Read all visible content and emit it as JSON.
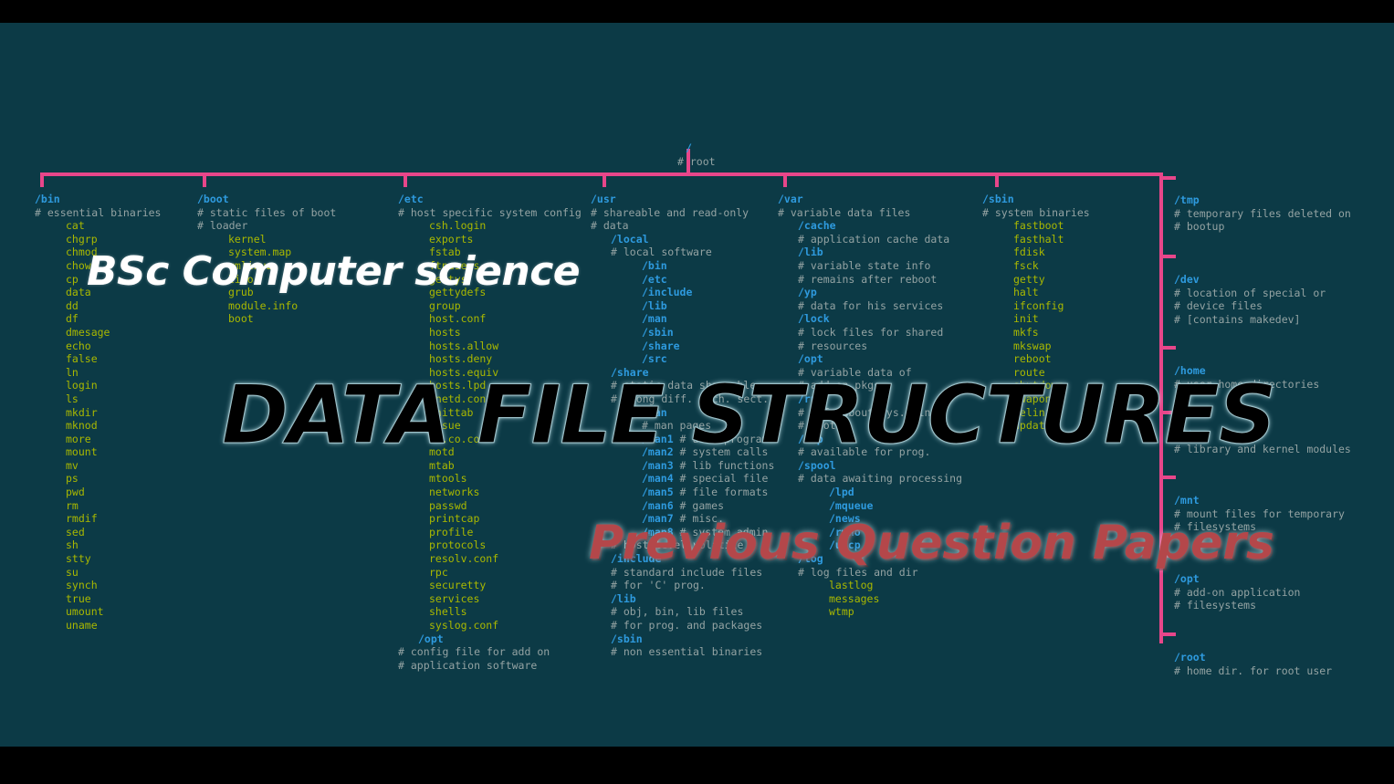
{
  "theme": {
    "background": "#0c3a46",
    "letterbox": "#000000",
    "line_color": "#e8468a",
    "dir_color": "#2e9ade",
    "file_color": "#a9b800",
    "comment_color": "#94a3a3"
  },
  "overlays": {
    "title_top": "BSc Computer science",
    "title_main": "DATA FILE STRUCTURES",
    "title_bottom": "Previous Question Papers"
  },
  "root": {
    "name": "/",
    "comment": "# root"
  },
  "columns": [
    {
      "name": "/bin",
      "comments": [
        "# essential binaries"
      ],
      "files": [
        "cat",
        "chgrp",
        "chmod",
        "chown",
        "cp",
        "data",
        "dd",
        "df",
        "dmesage",
        "echo",
        "false",
        "ln",
        "login",
        "ls",
        "mkdir",
        "mknod",
        "more",
        "mount",
        "mv",
        "ps",
        "pwd",
        "rm",
        "rmdif",
        "sed",
        "sh",
        "stty",
        "su",
        "synch",
        "true",
        "umount",
        "uname"
      ]
    },
    {
      "name": "/boot",
      "comments": [
        "# static files of boot",
        "# loader"
      ],
      "files": [
        "kernel",
        "system.map",
        "vmlinuz",
        "lilo",
        "grub",
        "module.info",
        "boot"
      ]
    },
    {
      "name": "/etc",
      "comments": [
        "# host specific system config"
      ],
      "files": [
        "csh.login",
        "exports",
        "fstab",
        "ftpusers",
        "gettys",
        "gettydefs",
        "group",
        "host.conf",
        "hosts",
        "hosts.allow",
        "hosts.deny",
        "hosts.equiv",
        "hosts.lpd",
        "inetd.conf",
        "inittab",
        "issue",
        "ls.co.conf",
        "motd",
        "mtab",
        "mtools",
        "networks",
        "passwd",
        "printcap",
        "profile",
        "protocols",
        "resolv.conf",
        "rpc",
        "securetty",
        "services",
        "shells",
        "syslog.conf"
      ],
      "tail": [
        {
          "type": "dir",
          "text": "/opt"
        },
        {
          "type": "cmt",
          "text": "# config file for add on"
        },
        {
          "type": "cmt",
          "text": "# application software"
        }
      ]
    },
    {
      "name": "/usr",
      "comments": [
        "# shareable and read-only",
        "# data"
      ],
      "nodes": [
        {
          "type": "dir",
          "indent": 1,
          "text": "/local"
        },
        {
          "type": "cmt",
          "indent": 1,
          "text": "# local software"
        },
        {
          "type": "dir",
          "indent": 3,
          "text": "/bin"
        },
        {
          "type": "dir",
          "indent": 3,
          "text": "/etc"
        },
        {
          "type": "dir",
          "indent": 3,
          "text": "/include"
        },
        {
          "type": "dir",
          "indent": 3,
          "text": "/lib"
        },
        {
          "type": "dir",
          "indent": 3,
          "text": "/man"
        },
        {
          "type": "dir",
          "indent": 3,
          "text": "/sbin"
        },
        {
          "type": "dir",
          "indent": 3,
          "text": "/share"
        },
        {
          "type": "dir",
          "indent": 3,
          "text": "/src"
        },
        {
          "type": "dir",
          "indent": 1,
          "text": "/share"
        },
        {
          "type": "cmt",
          "indent": 1,
          "text": "# static data shareable"
        },
        {
          "type": "cmt",
          "indent": 1,
          "text": "# among diff. arch. sect."
        },
        {
          "type": "dir",
          "indent": 3,
          "text": "/man"
        },
        {
          "type": "cmt",
          "indent": 3,
          "text": "# man pages"
        },
        {
          "type": "pair",
          "indent": 3,
          "dir": "/man1",
          "cmt": "# user programs"
        },
        {
          "type": "pair",
          "indent": 3,
          "dir": "/man2",
          "cmt": "# system calls"
        },
        {
          "type": "pair",
          "indent": 3,
          "dir": "/man3",
          "cmt": "# lib functions"
        },
        {
          "type": "pair",
          "indent": 3,
          "dir": "/man4",
          "cmt": "# special file"
        },
        {
          "type": "pair",
          "indent": 3,
          "dir": "/man5",
          "cmt": "# file formats"
        },
        {
          "type": "pair",
          "indent": 3,
          "dir": "/man6",
          "cmt": "# games"
        },
        {
          "type": "pair",
          "indent": 3,
          "dir": "/man7",
          "cmt": "# misc."
        },
        {
          "type": "pair",
          "indent": 3,
          "dir": "/man8",
          "cmt": "# system admin"
        },
        {
          "type": "cmt",
          "indent": 1,
          "text": "# host level volatile"
        },
        {
          "type": "dir",
          "indent": 1,
          "text": "/include"
        },
        {
          "type": "cmt",
          "indent": 1,
          "text": "# standard include files"
        },
        {
          "type": "cmt",
          "indent": 1,
          "text": "# for 'C' prog."
        },
        {
          "type": "dir",
          "indent": 1,
          "text": "/lib"
        },
        {
          "type": "cmt",
          "indent": 1,
          "text": "# obj, bin, lib files"
        },
        {
          "type": "cmt",
          "indent": 1,
          "text": "# for prog. and packages"
        },
        {
          "type": "dir",
          "indent": 1,
          "text": "/sbin"
        },
        {
          "type": "cmt",
          "indent": 1,
          "text": "# non essential binaries"
        }
      ]
    },
    {
      "name": "/var",
      "comments": [
        "# variable data files"
      ],
      "nodes": [
        {
          "type": "dir",
          "indent": 1,
          "text": "/cache"
        },
        {
          "type": "cmt",
          "indent": 1,
          "text": "# application cache data"
        },
        {
          "type": "dir",
          "indent": 1,
          "text": "/lib"
        },
        {
          "type": "cmt",
          "indent": 1,
          "text": "# variable state info"
        },
        {
          "type": "cmt",
          "indent": 1,
          "text": "# remains after reboot"
        },
        {
          "type": "dir",
          "indent": 1,
          "text": "/yp"
        },
        {
          "type": "cmt",
          "indent": 1,
          "text": "# data for his services"
        },
        {
          "type": "dir",
          "indent": 1,
          "text": "/lock"
        },
        {
          "type": "cmt",
          "indent": 1,
          "text": "# lock files for shared"
        },
        {
          "type": "cmt",
          "indent": 1,
          "text": "# resources"
        },
        {
          "type": "dir",
          "indent": 1,
          "text": "/opt"
        },
        {
          "type": "cmt",
          "indent": 1,
          "text": "# variable data of"
        },
        {
          "type": "cmt",
          "indent": 1,
          "text": "# add-on pkgs"
        },
        {
          "type": "dir",
          "indent": 1,
          "text": "/run"
        },
        {
          "type": "cmt",
          "indent": 1,
          "text": "# info about sys. since"
        },
        {
          "type": "cmt",
          "indent": 1,
          "text": "# boot"
        },
        {
          "type": "dir",
          "indent": 1,
          "text": "/tmp"
        },
        {
          "type": "cmt",
          "indent": 1,
          "text": "# available for prog."
        },
        {
          "type": "dir",
          "indent": 1,
          "text": "/spool"
        },
        {
          "type": "cmt",
          "indent": 1,
          "text": "# data awaiting processing"
        },
        {
          "type": "dir",
          "indent": 3,
          "text": "/lpd"
        },
        {
          "type": "dir",
          "indent": 3,
          "text": "/mqueue"
        },
        {
          "type": "dir",
          "indent": 3,
          "text": "/news"
        },
        {
          "type": "dir",
          "indent": 3,
          "text": "/rwho"
        },
        {
          "type": "dir",
          "indent": 3,
          "text": "/uucp"
        },
        {
          "type": "dir",
          "indent": 1,
          "text": "/log"
        },
        {
          "type": "cmt",
          "indent": 1,
          "text": "# log files and dir"
        },
        {
          "type": "file",
          "indent": 3,
          "text": "lastlog"
        },
        {
          "type": "file",
          "indent": 3,
          "text": "messages"
        },
        {
          "type": "file",
          "indent": 3,
          "text": "wtmp"
        }
      ]
    },
    {
      "name": "/sbin",
      "comments": [
        "# system binaries"
      ],
      "files": [
        "fastboot",
        "fasthalt",
        "fdisk",
        "fsck",
        "getty",
        "halt",
        "ifconfig",
        "init",
        "mkfs",
        "mkswap",
        "reboot",
        "route",
        "shutdown",
        "swapon",
        "telinit",
        "update"
      ]
    }
  ],
  "right_branch": [
    {
      "name": "/tmp",
      "comments": [
        "# temporary files deleted on",
        "# bootup"
      ]
    },
    {
      "name": "/dev",
      "comments": [
        "# location of special or",
        "# device files",
        "# [contains makedev]"
      ]
    },
    {
      "name": "/home",
      "comments": [
        "# user home directories"
      ]
    },
    {
      "name": "/lib",
      "comments": [
        "# library and kernel modules"
      ]
    },
    {
      "name": "/mnt",
      "comments": [
        "# mount files for temporary",
        "# filesystems"
      ]
    },
    {
      "name": "/opt",
      "comments": [
        "# add-on application",
        "# filesystems"
      ]
    },
    {
      "name": "/root",
      "comments": [
        "# home dir. for root user"
      ]
    }
  ]
}
